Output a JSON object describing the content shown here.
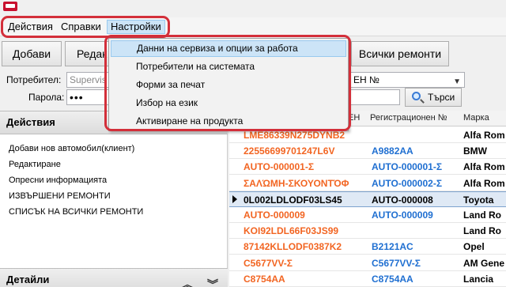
{
  "menubar": {
    "items": [
      "Действия",
      "Справки",
      "Настройки"
    ]
  },
  "settings_menu": {
    "items": [
      "Данни на сервиза и опции за работа",
      "Потребители на системата",
      "Форми за печат",
      "Избор на език",
      "Активиране на продукта"
    ]
  },
  "toolbar": {
    "add_label": "Добави",
    "edit_label": "Редак",
    "all_repairs_label": "Всички ремонти"
  },
  "login": {
    "user_label": "Потребител:",
    "user_value": "Supervis",
    "password_label": "Парола:",
    "password_value": "•••",
    "filter_combo_value": "ЕН №",
    "search_label": "Търси"
  },
  "actions_panel": {
    "title": "Действия",
    "items": [
      "Добави нов автомобил(клиент)",
      "Редактиране",
      "Опресни информацията",
      "ИЗВЪРШЕНИ РЕМОНТИ",
      "СПИСЪК НА ВСИЧКИ РЕМОНТИ"
    ],
    "details_title": "Детайли"
  },
  "grid": {
    "columns": [
      "ЕН",
      "Регистрационен №",
      "Марка"
    ],
    "rows": [
      {
        "vin": "LME86339N275DYNB2",
        "reg": "",
        "make": "Alfa Rom"
      },
      {
        "vin": "22556699701247L6V",
        "reg": "A9882AA",
        "make": "BMW"
      },
      {
        "vin": "AUTO-000001-Σ",
        "reg": "AUTO-000001-Σ",
        "make": "Alfa Rom"
      },
      {
        "vin": "ΣΑΛΏΜΗ-ΣΚΟΥΟΝΤΌΦ",
        "reg": "AUTO-000002-Σ",
        "make": "Alfa Rom"
      },
      {
        "vin": "0L002LDLODF03LS45",
        "reg": "AUTO-000008",
        "make": "Toyota"
      },
      {
        "vin": "AUTO-000009",
        "reg": "AUTO-000009",
        "make": "Land Ro"
      },
      {
        "vin": "KOI92LDL66F03JS99",
        "reg": "",
        "make": "Land Ro"
      },
      {
        "vin": "87142KLLODF0387K2",
        "reg": "B2121AC",
        "make": "Opel"
      },
      {
        "vin": "C5677VV-Σ",
        "reg": "C5677VV-Σ",
        "make": "AM Gene"
      },
      {
        "vin": "C8754AA",
        "reg": "C8754AA",
        "make": "Lancia"
      }
    ]
  },
  "colors": {
    "highlight_ring": "#d32f3a",
    "vin_text": "#f26522",
    "reg_text": "#1f6fd1"
  }
}
